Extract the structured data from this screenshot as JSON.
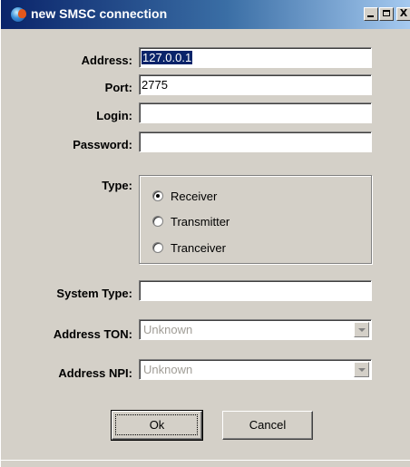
{
  "window": {
    "title": "new SMSC connection",
    "icon": "app-globe-icon",
    "controls": {
      "minimize": "minimize-icon",
      "maximize": "maximize-icon",
      "close_label": "X"
    }
  },
  "form": {
    "address": {
      "label": "Address:",
      "value": "127.0.0.1",
      "selected": true
    },
    "port": {
      "label": "Port:",
      "value": "2775"
    },
    "login": {
      "label": "Login:",
      "value": ""
    },
    "password": {
      "label": "Password:",
      "value": ""
    },
    "type": {
      "label": "Type:",
      "options": [
        {
          "label": "Receiver",
          "checked": true
        },
        {
          "label": "Transmitter",
          "checked": false
        },
        {
          "label": "Tranceiver",
          "checked": false
        }
      ]
    },
    "system_type": {
      "label": "System Type:",
      "value": ""
    },
    "address_ton": {
      "label": "Address TON:",
      "value": "Unknown",
      "enabled": false
    },
    "address_npi": {
      "label": "Address NPI:",
      "value": "Unknown",
      "enabled": false
    }
  },
  "buttons": {
    "ok": "Ok",
    "cancel": "Cancel"
  },
  "colors": {
    "title_bar_start": "#0a246a",
    "title_bar_end": "#a6caf0",
    "dialog_face": "#d4d0c8",
    "selection": "#0a246a",
    "disabled_text": "#a09d96"
  }
}
